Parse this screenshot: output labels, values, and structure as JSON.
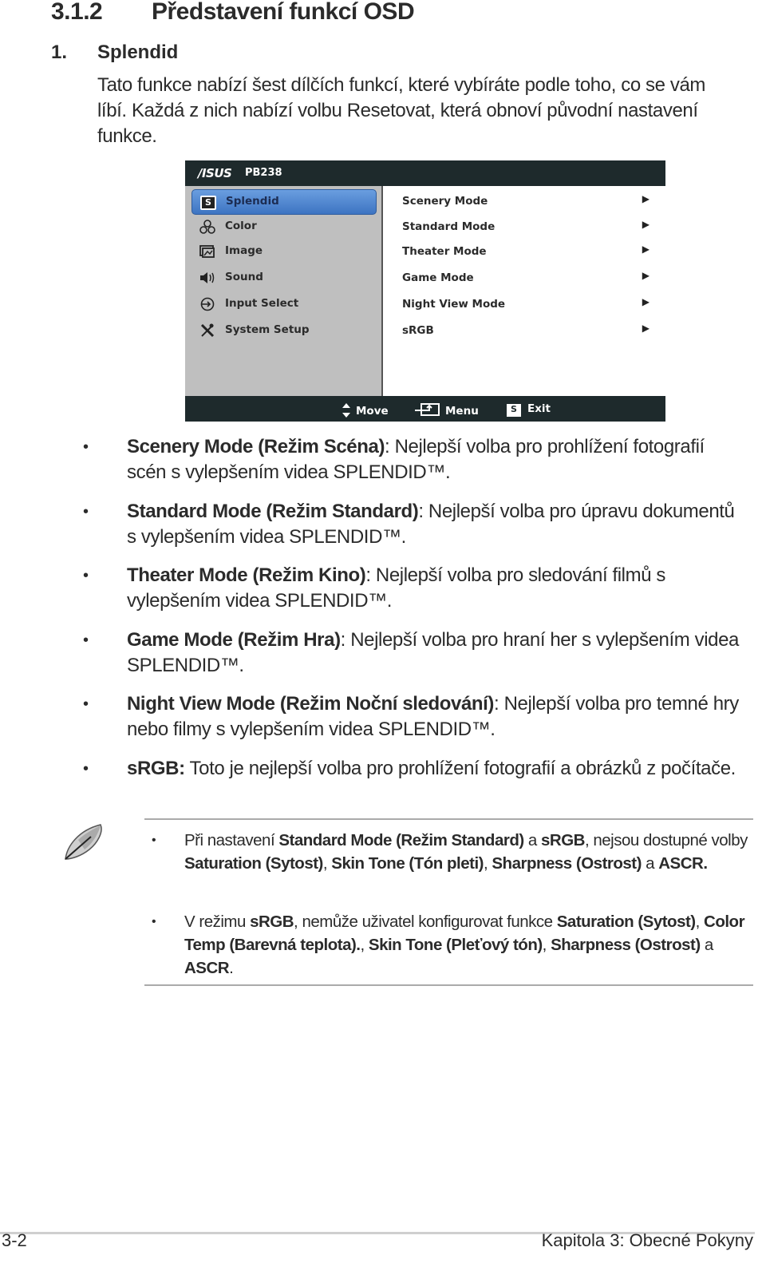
{
  "section": {
    "number": "3.1.2",
    "title": "Představení funkcí OSD"
  },
  "item": {
    "number": "1.",
    "title": "Splendid"
  },
  "intro": "Tato funkce nabízí šest dílčích funkcí, které vybíráte podle toho, co se vám líbí. Každá z nich nabízí volbu Resetovat, která obnoví původní nastavení funkce.",
  "osd": {
    "brand": "/ISUS",
    "model": "PB238",
    "colors": {
      "header": "#1e2a2c",
      "left_panel": "#bfbfbf",
      "selected": "#4a82d0",
      "right_panel": "#ffffff"
    },
    "menu": [
      {
        "label": "Splendid",
        "icon": "splendid-s-icon",
        "selected": true
      },
      {
        "label": "Color",
        "icon": "color-rgb-icon",
        "selected": false
      },
      {
        "label": "Image",
        "icon": "image-icon",
        "selected": false
      },
      {
        "label": "Sound",
        "icon": "speaker-icon",
        "selected": false
      },
      {
        "label": "Input Select",
        "icon": "input-select-icon",
        "selected": false
      },
      {
        "label": "System Setup",
        "icon": "tools-icon",
        "selected": false
      }
    ],
    "submenu": [
      {
        "label": "Scenery Mode",
        "arrow": "▶"
      },
      {
        "label": "Standard Mode",
        "arrow": "▶"
      },
      {
        "label": "Theater Mode",
        "arrow": "▶"
      },
      {
        "label": "Game Mode",
        "arrow": "▶"
      },
      {
        "label": "Night View Mode",
        "arrow": "▶"
      },
      {
        "label": "sRGB",
        "arrow": "▶"
      }
    ],
    "footer": {
      "move": "Move",
      "menu": "Menu",
      "exit": "Exit",
      "s_glyph": "S"
    }
  },
  "bullets": [
    {
      "bold": "Scenery Mode (Režim Scéna)",
      "text": ": Nejlepší volba pro prohlížení fotografií scén s vylepšením videa SPLENDID™."
    },
    {
      "bold": "Standard Mode (Režim Standard)",
      "text": ": Nejlepší volba pro úpravu dokumentů s vylepšením videa SPLENDID™."
    },
    {
      "bold": "Theater Mode (Režim Kino)",
      "text": ": Nejlepší volba pro sledování filmů s vylepšením videa SPLENDID™."
    },
    {
      "bold": "Game Mode (Režim Hra)",
      "text": ": Nejlepší volba pro hraní her s vylepšením videa SPLENDID™."
    },
    {
      "bold": "Night View Mode (Režim Noční sledování)",
      "text": ": Nejlepší volba pro temné hry nebo filmy s vylepšením videa SPLENDID™."
    },
    {
      "bold": "sRGB:",
      "text": " Toto je nejlepší volba pro prohlížení fotografií a obrázků z počítače."
    }
  ],
  "notes": [
    {
      "parts": [
        {
          "t": "Při nastavení ",
          "b": false
        },
        {
          "t": "Standard Mode (Režim Standard)",
          "b": true
        },
        {
          "t": " a ",
          "b": false
        },
        {
          "t": "sRGB",
          "b": true
        },
        {
          "t": ", nejsou dostupné volby ",
          "b": false
        },
        {
          "t": "Saturation (Sytost)",
          "b": true
        },
        {
          "t": ", ",
          "b": false
        },
        {
          "t": "Skin Tone (Tón pleti)",
          "b": true
        },
        {
          "t": ", ",
          "b": false
        },
        {
          "t": "Sharpness (Ostrost)",
          "b": true
        },
        {
          "t": " a ",
          "b": false
        },
        {
          "t": "ASCR.",
          "b": true
        }
      ]
    },
    {
      "parts": [
        {
          "t": "V režimu ",
          "b": false
        },
        {
          "t": "sRGB",
          "b": true
        },
        {
          "t": ", nemůže uživatel konfigurovat funkce ",
          "b": false
        },
        {
          "t": "Saturation (Sytost)",
          "b": true
        },
        {
          "t": ", ",
          "b": false
        },
        {
          "t": "Color Temp (Barevná teplota).",
          "b": true
        },
        {
          "t": ", ",
          "b": false
        },
        {
          "t": "Skin Tone (Pleťový tón)",
          "b": true
        },
        {
          "t": ", ",
          "b": false
        },
        {
          "t": "Sharpness (Ostrost)",
          "b": true
        },
        {
          "t": " a ",
          "b": false
        },
        {
          "t": "ASCR",
          "b": true
        },
        {
          "t": ".",
          "b": false
        }
      ]
    }
  ],
  "footer": {
    "page_number": "3-2",
    "chapter": "Kapitola 3: Obecné Pokyny"
  },
  "glyphs": {
    "bullet": "•"
  }
}
